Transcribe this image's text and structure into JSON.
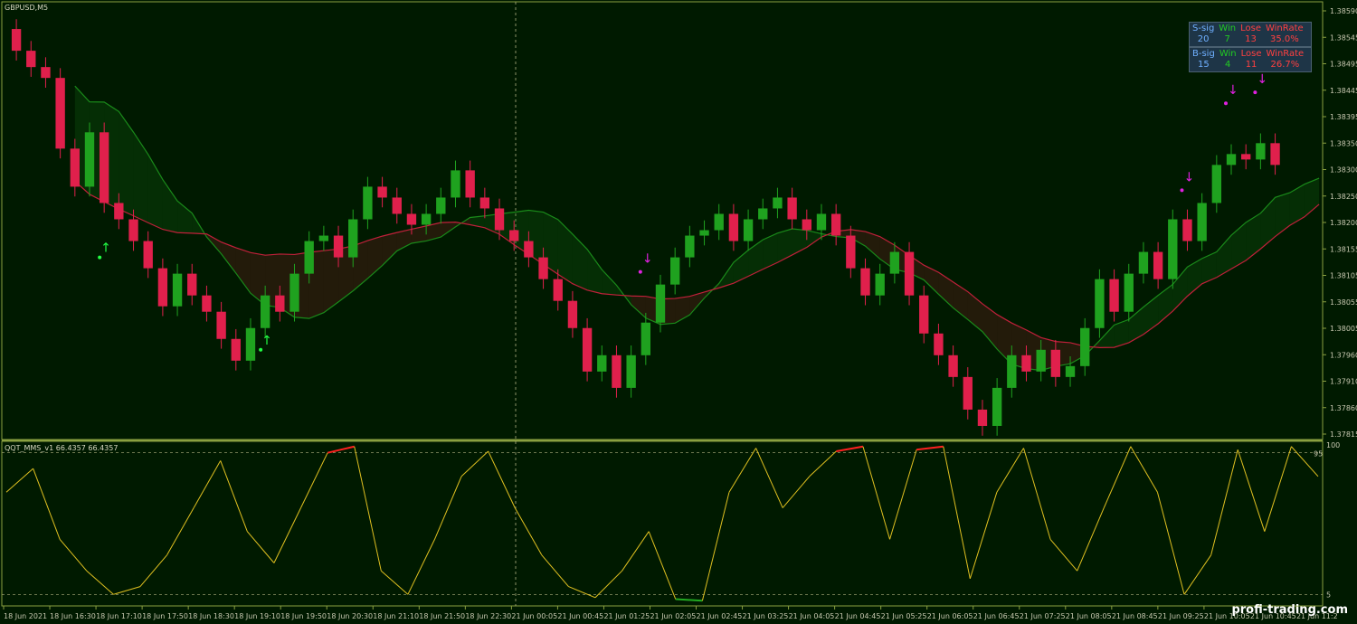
{
  "chart_title": "GBPUSD,M5",
  "indicator_title": "QQT_MMS_v1 66.4357 66.4357",
  "colors": {
    "background": "#001a00",
    "frame": "#8aa040",
    "bull": "#1fa21f",
    "bear": "#e0204c",
    "cloud_up": "#1a8a1a",
    "cloud_down": "#c0203a",
    "osc": "#e0c020",
    "overbought": "#ff2020",
    "oversold": "#22aa22",
    "signal_sell": "#e020e0",
    "signal_buy": "#22ff44"
  },
  "stats": [
    {
      "headers": [
        "S-sig",
        "Win",
        "Lose",
        "WinRate"
      ],
      "values": [
        "20",
        "7",
        "13",
        "35.0%"
      ]
    },
    {
      "headers": [
        "B-sig",
        "Win",
        "Lose",
        "WinRate"
      ],
      "values": [
        "15",
        "4",
        "11",
        "26.7%"
      ]
    }
  ],
  "price_axis": [
    "1.38590",
    "1.38545",
    "1.38495",
    "1.38445",
    "1.38395",
    "1.38350",
    "1.38300",
    "1.38250",
    "1.38200",
    "1.38155",
    "1.38105",
    "1.38055",
    "1.38005",
    "1.37960",
    "1.37910",
    "1.37860",
    "1.37815"
  ],
  "osc_axis": [
    "100",
    "95",
    "5"
  ],
  "time_axis": [
    "18 Jun 2021",
    "18 Jun 16:30",
    "18 Jun 17:10",
    "18 Jun 17:50",
    "18 Jun 18:30",
    "18 Jun 19:10",
    "18 Jun 19:50",
    "18 Jun 20:30",
    "18 Jun 21:10",
    "18 Jun 21:50",
    "18 Jun 22:30",
    "21 Jun 00:05",
    "21 Jun 00:45",
    "21 Jun 01:25",
    "21 Jun 02:05",
    "21 Jun 02:45",
    "21 Jun 03:25",
    "21 Jun 04:05",
    "21 Jun 04:45",
    "21 Jun 05:25",
    "21 Jun 06:05",
    "21 Jun 06:45",
    "21 Jun 07:25",
    "21 Jun 08:05",
    "21 Jun 08:45",
    "21 Jun 09:25",
    "21 Jun 10:05",
    "21 Jun 10:45",
    "21 Jun 11:2"
  ],
  "watermark": "profi-trading.com",
  "chart_data": {
    "type": "candlestick",
    "symbol": "GBPUSD",
    "timeframe": "M5",
    "price_range": [
      1.37815,
      1.3862
    ],
    "oscillator_range": [
      0,
      100
    ],
    "close_trail": [
      1.3853,
      1.385,
      1.3848,
      1.3835,
      1.3828,
      1.3838,
      1.3825,
      1.3822,
      1.3818,
      1.3813,
      1.3806,
      1.3812,
      1.3808,
      1.3805,
      1.38,
      1.3796,
      1.3802,
      1.3808,
      1.3805,
      1.3812,
      1.3818,
      1.3819,
      1.3815,
      1.3822,
      1.3828,
      1.3826,
      1.3823,
      1.3821,
      1.3823,
      1.3826,
      1.3831,
      1.3826,
      1.3824,
      1.382,
      1.3818,
      1.3815,
      1.3811,
      1.3807,
      1.3802,
      1.3794,
      1.3797,
      1.3791,
      1.3797,
      1.3803,
      1.381,
      1.3815,
      1.3819,
      1.382,
      1.3823,
      1.3818,
      1.3822,
      1.3824,
      1.3826,
      1.3822,
      1.382,
      1.3823,
      1.3819,
      1.3813,
      1.3808,
      1.3812,
      1.3816,
      1.3808,
      1.3801,
      1.3797,
      1.3793,
      1.3787,
      1.3784,
      1.3791,
      1.3797,
      1.3794,
      1.3798,
      1.3793,
      1.3795,
      1.3802,
      1.3811,
      1.3805,
      1.3812,
      1.3816,
      1.3811,
      1.3822,
      1.3818,
      1.3825,
      1.3832,
      1.3834,
      1.3833,
      1.3836,
      1.3832
    ],
    "osc_trail": [
      70,
      85,
      40,
      20,
      5,
      10,
      30,
      60,
      90,
      45,
      25,
      60,
      95,
      99,
      20,
      5,
      40,
      80,
      96,
      60,
      30,
      10,
      3,
      20,
      45,
      2,
      1,
      70,
      98,
      60,
      80,
      96,
      99,
      40,
      97,
      99,
      15,
      70,
      98,
      40,
      20,
      60,
      99,
      70,
      5,
      30,
      97,
      45,
      99,
      80
    ]
  }
}
